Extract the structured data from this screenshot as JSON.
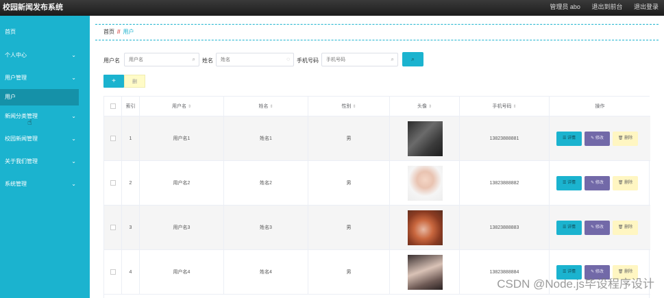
{
  "app": {
    "title": "校园新闻发布系统"
  },
  "topbar": {
    "user_label": "管理员 abo",
    "back_label": "退出到前台",
    "logout_label": "退出登录"
  },
  "sidebar": {
    "items": [
      {
        "label": "首页",
        "has_children": false,
        "active": false
      },
      {
        "label": "个人中心",
        "has_children": true,
        "active": false
      },
      {
        "label": "用户管理",
        "has_children": true,
        "active": false
      },
      {
        "label": "用户",
        "has_children": false,
        "active": true
      },
      {
        "label": "新闻分类管理",
        "has_children": true,
        "active": false
      },
      {
        "label": "校园新闻管理",
        "has_children": true,
        "active": false
      },
      {
        "label": "关于我们管理",
        "has_children": true,
        "active": false
      },
      {
        "label": "系统管理",
        "has_children": true,
        "active": false
      }
    ],
    "chevron": "⌄"
  },
  "breadcrumb": {
    "home": "首页",
    "separator": "//",
    "current": "用户"
  },
  "search": {
    "username_label": "用户名",
    "username_placeholder": "用户名",
    "name_label": "姓名",
    "name_placeholder": "姓名",
    "phone_label": "手机号码",
    "phone_placeholder": "手机号码"
  },
  "actions": {
    "add_label": "+",
    "delete_label": "删"
  },
  "table": {
    "headers": {
      "index": "索引",
      "username": "用户名",
      "name": "姓名",
      "gender": "性别",
      "avatar": "头像",
      "phone": "手机号码",
      "ops": "操作"
    },
    "sort_glyph": "⇕",
    "op_labels": {
      "detail": "详情",
      "edit": "修改",
      "delete": "删除"
    },
    "rows": [
      {
        "index": "1",
        "username": "用户名1",
        "name": "姓名1",
        "gender": "男",
        "phone": "13823888881",
        "avatar": "avatar-photo-1"
      },
      {
        "index": "2",
        "username": "用户名2",
        "name": "姓名2",
        "gender": "男",
        "phone": "13823888882",
        "avatar": "avatar-photo-2"
      },
      {
        "index": "3",
        "username": "用户名3",
        "name": "姓名3",
        "gender": "男",
        "phone": "13823888883",
        "avatar": "avatar-photo-3"
      },
      {
        "index": "4",
        "username": "用户名4",
        "name": "姓名4",
        "gender": "男",
        "phone": "13823888884",
        "avatar": "avatar-photo-4"
      }
    ]
  },
  "watermark": "CSDN @Node.js毕设程序设计",
  "colors": {
    "accent": "#1bb3cf",
    "sidebar_active": "#1591a8",
    "edit": "#7269a8",
    "delete": "#fff6c2"
  }
}
